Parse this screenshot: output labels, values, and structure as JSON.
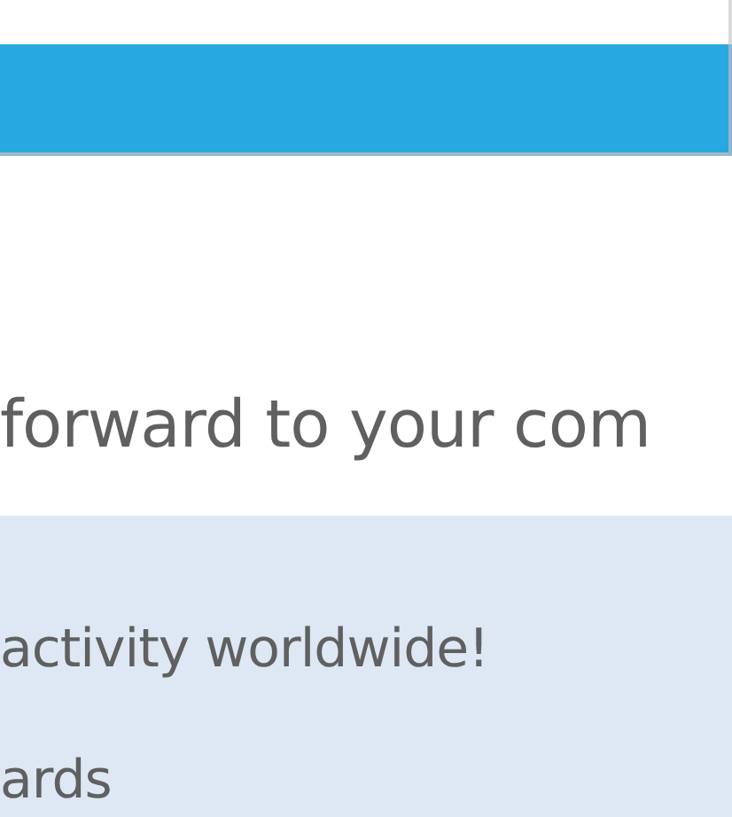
{
  "heading": "forward to your com",
  "panel": {
    "lines": [
      "activity worldwide!",
      "ards"
    ]
  }
}
